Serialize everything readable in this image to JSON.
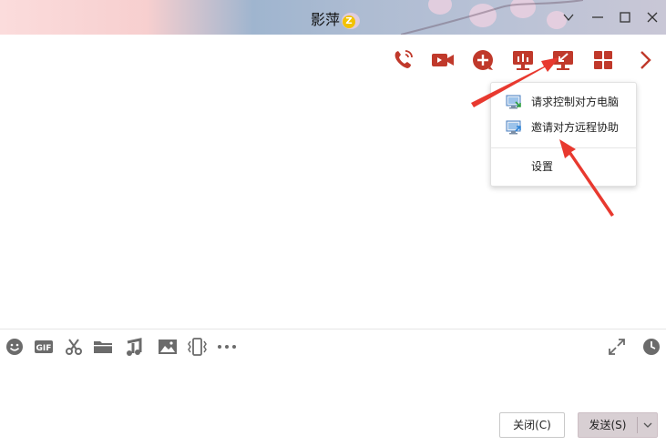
{
  "window": {
    "title": "影萍",
    "badge_icon": "vip-z-badge-icon",
    "badge_text": "Z",
    "controls": [
      "chevron-down-icon",
      "minimize-icon",
      "maximize-icon",
      "close-icon"
    ]
  },
  "top_toolbar": {
    "icons": [
      "phone-icon",
      "video-call-icon",
      "add-icon",
      "share-screen-icon",
      "remote-desktop-icon",
      "apps-grid-icon",
      "chevron-right-icon"
    ],
    "accent_color": "#c0392b"
  },
  "remote_menu": {
    "items": [
      {
        "label": "请求控制对方电脑",
        "icon": "remote-control-icon"
      },
      {
        "label": "邀请对方远程协助",
        "icon": "remote-assist-icon"
      }
    ],
    "settings_label": "设置"
  },
  "bottom_toolbar": {
    "icons": [
      "emoji-icon",
      "gif-icon",
      "scissors-icon",
      "folder-icon",
      "music-icon",
      "image-icon",
      "shake-icon",
      "more-icon",
      "expand-icon",
      "clock-icon"
    ],
    "gif_text": "GIF"
  },
  "buttons": {
    "close_label": "关闭(C)",
    "send_label": "发送(S)"
  },
  "annotations": {
    "arrow_color": "#e8392f",
    "arrows": [
      "arrow-to-remote-desktop-icon",
      "arrow-to-invite-remote-assist"
    ]
  }
}
